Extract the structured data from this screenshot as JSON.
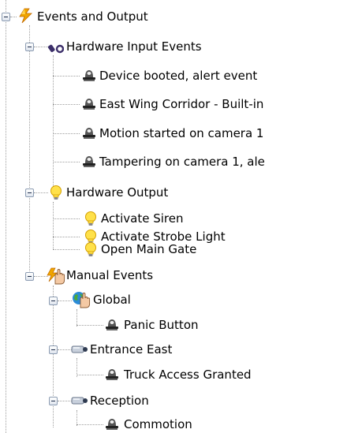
{
  "tree": {
    "root": {
      "label": "Events and Output",
      "icon": "lightning-bolt-icon"
    },
    "groups": [
      {
        "label": "Hardware Input Events",
        "icon": "hardware-input-icon",
        "items": [
          {
            "label": "Device booted, alert event",
            "icon": "event-light-icon"
          },
          {
            "label": "East Wing Corridor - Built-in",
            "icon": "event-light-icon"
          },
          {
            "label": "Motion started on camera 1",
            "icon": "event-light-icon"
          },
          {
            "label": "Tampering on camera 1, ale",
            "icon": "event-light-icon"
          }
        ]
      },
      {
        "label": "Hardware Output",
        "icon": "lightbulb-icon",
        "items": [
          {
            "label": "Activate Siren",
            "icon": "lightbulb-icon"
          },
          {
            "label": "Activate Strobe Light",
            "icon": "lightbulb-icon"
          },
          {
            "label": "Open Main Gate",
            "icon": "lightbulb-icon"
          }
        ]
      },
      {
        "label": "Manual Events",
        "icon": "manual-event-hand-icon",
        "subgroups": [
          {
            "label": "Global",
            "icon": "globe-hand-icon",
            "items": [
              {
                "label": "Panic Button",
                "icon": "event-light-icon"
              }
            ]
          },
          {
            "label": "Entrance East",
            "icon": "camera-icon",
            "items": [
              {
                "label": "Truck Access Granted",
                "icon": "event-light-icon"
              }
            ]
          },
          {
            "label": "Reception",
            "icon": "camera-icon",
            "items": [
              {
                "label": "Commotion",
                "icon": "event-light-icon"
              }
            ]
          }
        ]
      }
    ]
  },
  "colors": {
    "bolt": "#f0a500",
    "bulb": "#ffe14a",
    "input_icon": "#3c2f6a",
    "globe": "#2b8bd6",
    "camera": "#8a97ad"
  }
}
